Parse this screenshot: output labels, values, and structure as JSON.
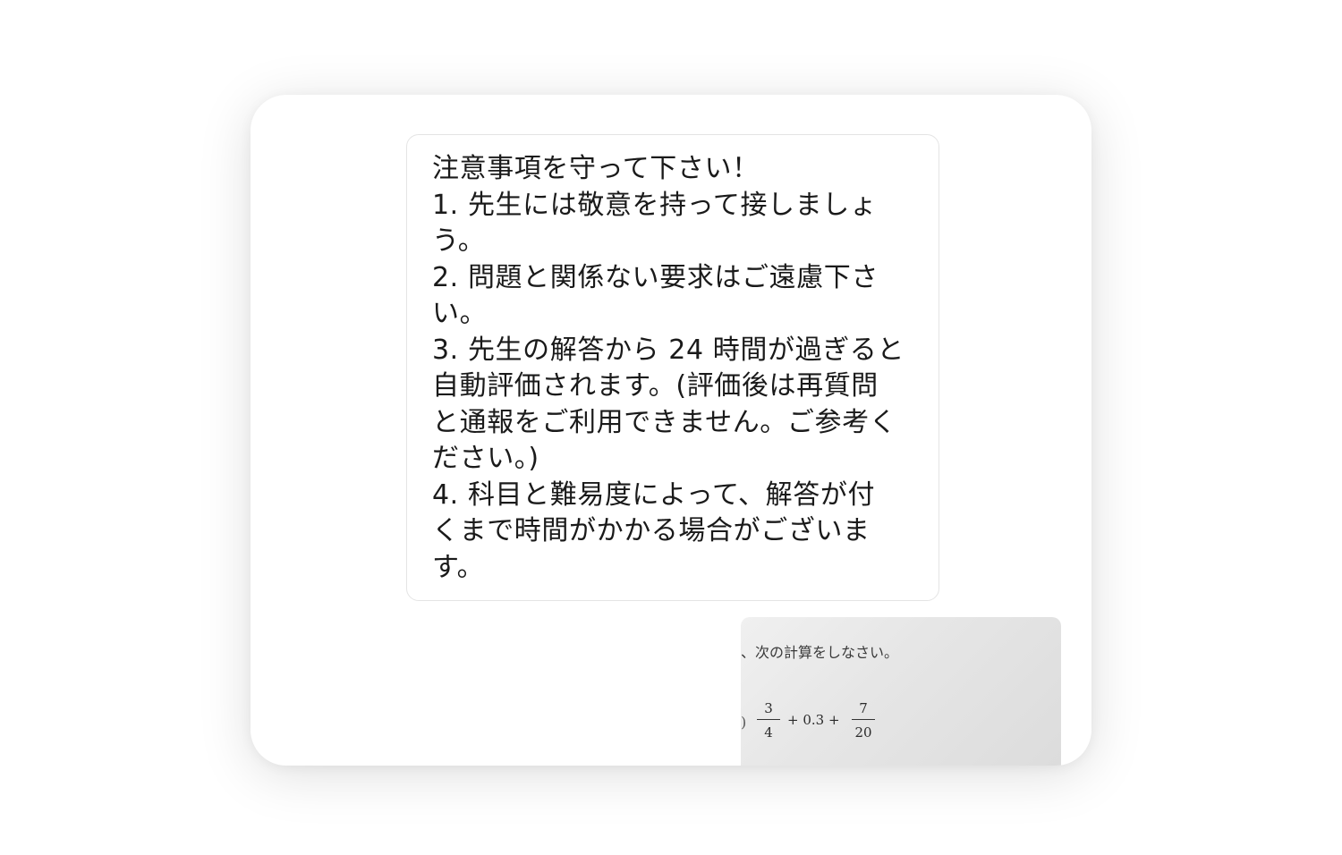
{
  "notice": {
    "lines": [
      "注意事項を守って下さい！",
      "1. 先生には敬意を持って接しましょ",
      "う。",
      "2. 問題と関係ない要求はご遠慮下さ",
      "い。",
      "3. 先生の解答から 24 時間が過ぎると",
      "自動評価されます。(評価後は再質問",
      "と通報をご利用できません。ご参考く",
      "ださい。)",
      "4. 科目と難易度によって、解答が付",
      "くまで時間がかかる場合がございま",
      "す。"
    ]
  },
  "attachment": {
    "instruction": "、次の計算をしなさい。",
    "paren": ")",
    "fraction1": {
      "numerator": "3",
      "denominator": "4"
    },
    "middle": "+ 0.3 +",
    "fraction2": {
      "numerator": "7",
      "denominator": "20"
    }
  }
}
